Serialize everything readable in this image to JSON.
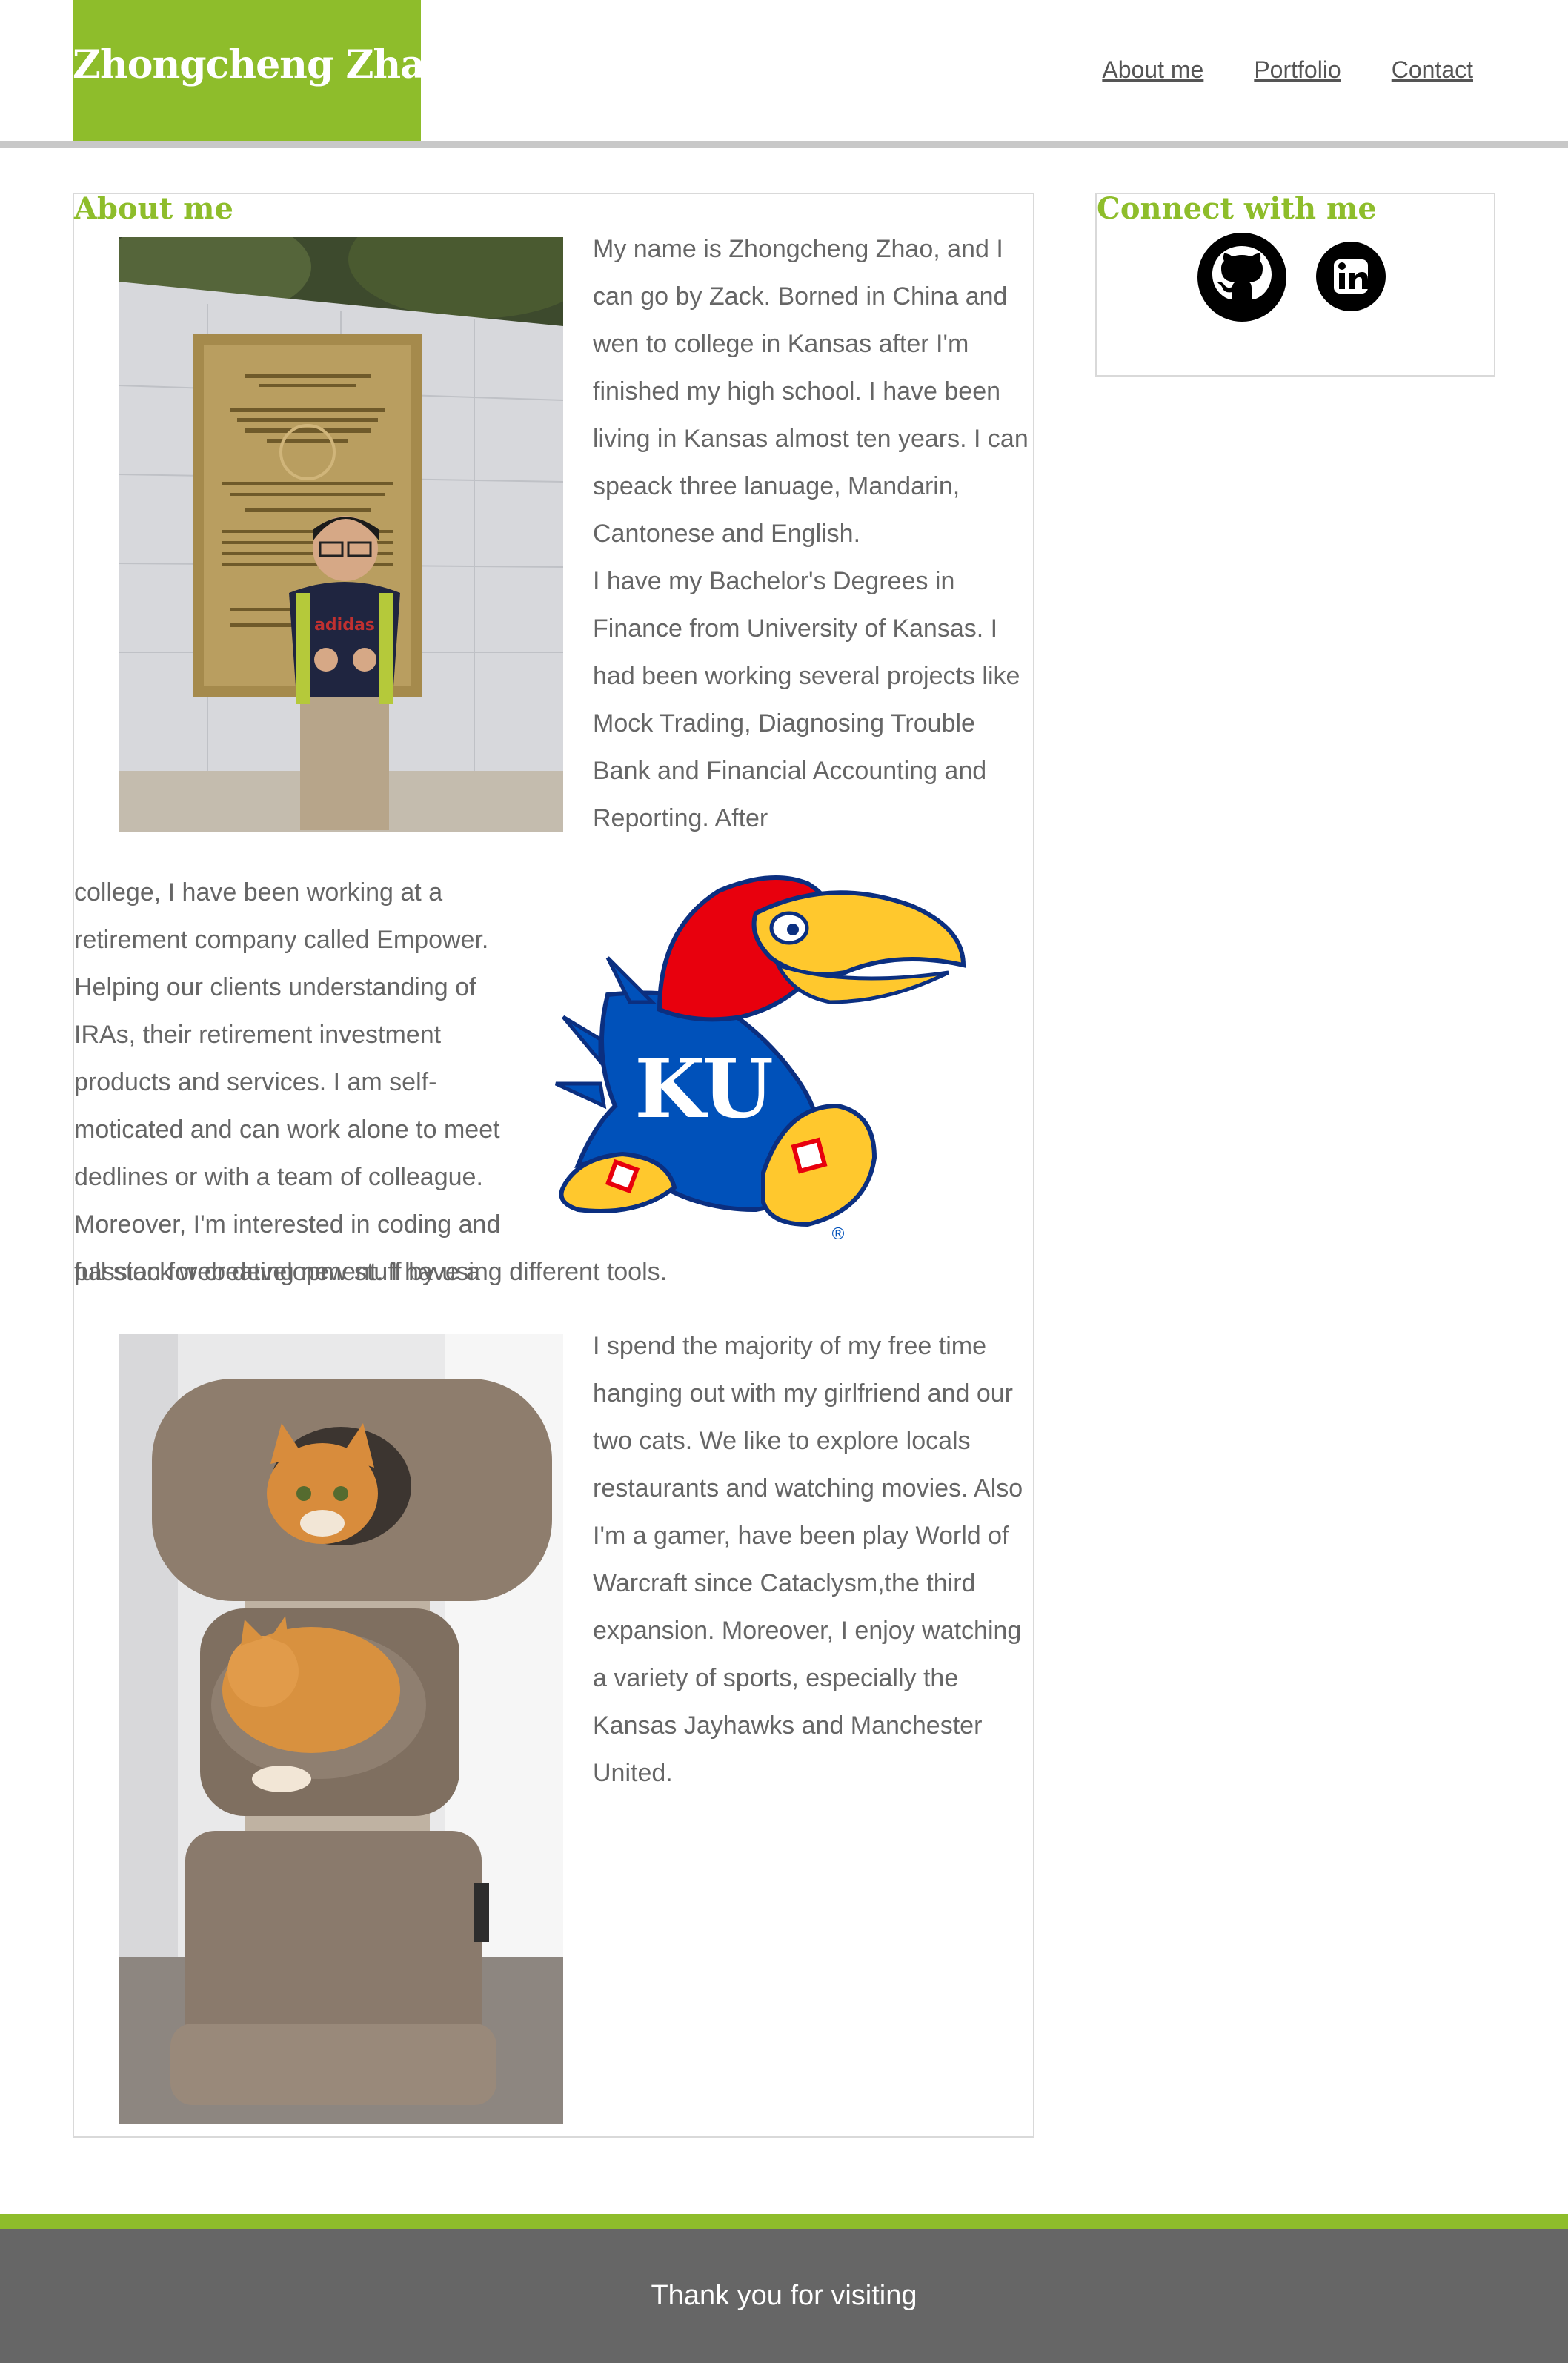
{
  "header": {
    "site_title": "Zhongcheng Zhao",
    "nav": [
      "About me",
      "Portfolio",
      "Contact"
    ]
  },
  "about": {
    "title": "About me",
    "paragraph1": "My name is Zhongcheng Zhao, and I can go by Zack. Borned in China and wen to college in Kansas after I'm finished my high school. I have been living in Kansas almost ten years. I can speack three lanuage, Mandarin, Cantonese and English.",
    "paragraph2_top": "I have my Bachelor's Degrees in Finance from University of Kansas. I had been working several projects like Mock Trading, Diagnosing Trouble Bank and Financial Accounting and Reporting. After",
    "paragraph2_bottom": "college, I have been working at a retirement company called Empower. Helping our clients understanding of IRAs, their retirement investment products and services. I am self-moticated and can work alone to meet dedlines or with a team of colleague. Moreover, I'm interested in coding and full stack web development. I have a",
    "paragraph2_last": "passion for creating new stuff by using different tools.",
    "paragraph3": "I spend the majority of my free time hanging out with my girlfriend and our two cats. We like to explore locals restaurants and watching movies. Also I'm a gamer, have been play World of Warcraft since Cataclysm,the third expansion. Moreover, I enjoy watching a variety of sports, especially the Kansas Jayhawks and Manchester United.",
    "plaque_text": "CONVENTION CONCERNING THE PROTECTION OF THE WORLD CULTURAL AND NATURAL HERITAGE",
    "logo_text": "KU",
    "logo_mark": "®"
  },
  "connect": {
    "title": "Connect with me",
    "links": [
      {
        "name": "GitHub",
        "icon": "github-icon"
      },
      {
        "name": "LinkedIn",
        "icon": "linkedin-icon"
      }
    ]
  },
  "footer": {
    "text": "Thank you for visiting"
  },
  "colors": {
    "accent": "#8ebd2b",
    "footer_bg": "#666666",
    "body_text": "#666666",
    "ku_blue": "#0051ba",
    "ku_red": "#e8000d",
    "ku_yellow": "#ffc82d"
  }
}
